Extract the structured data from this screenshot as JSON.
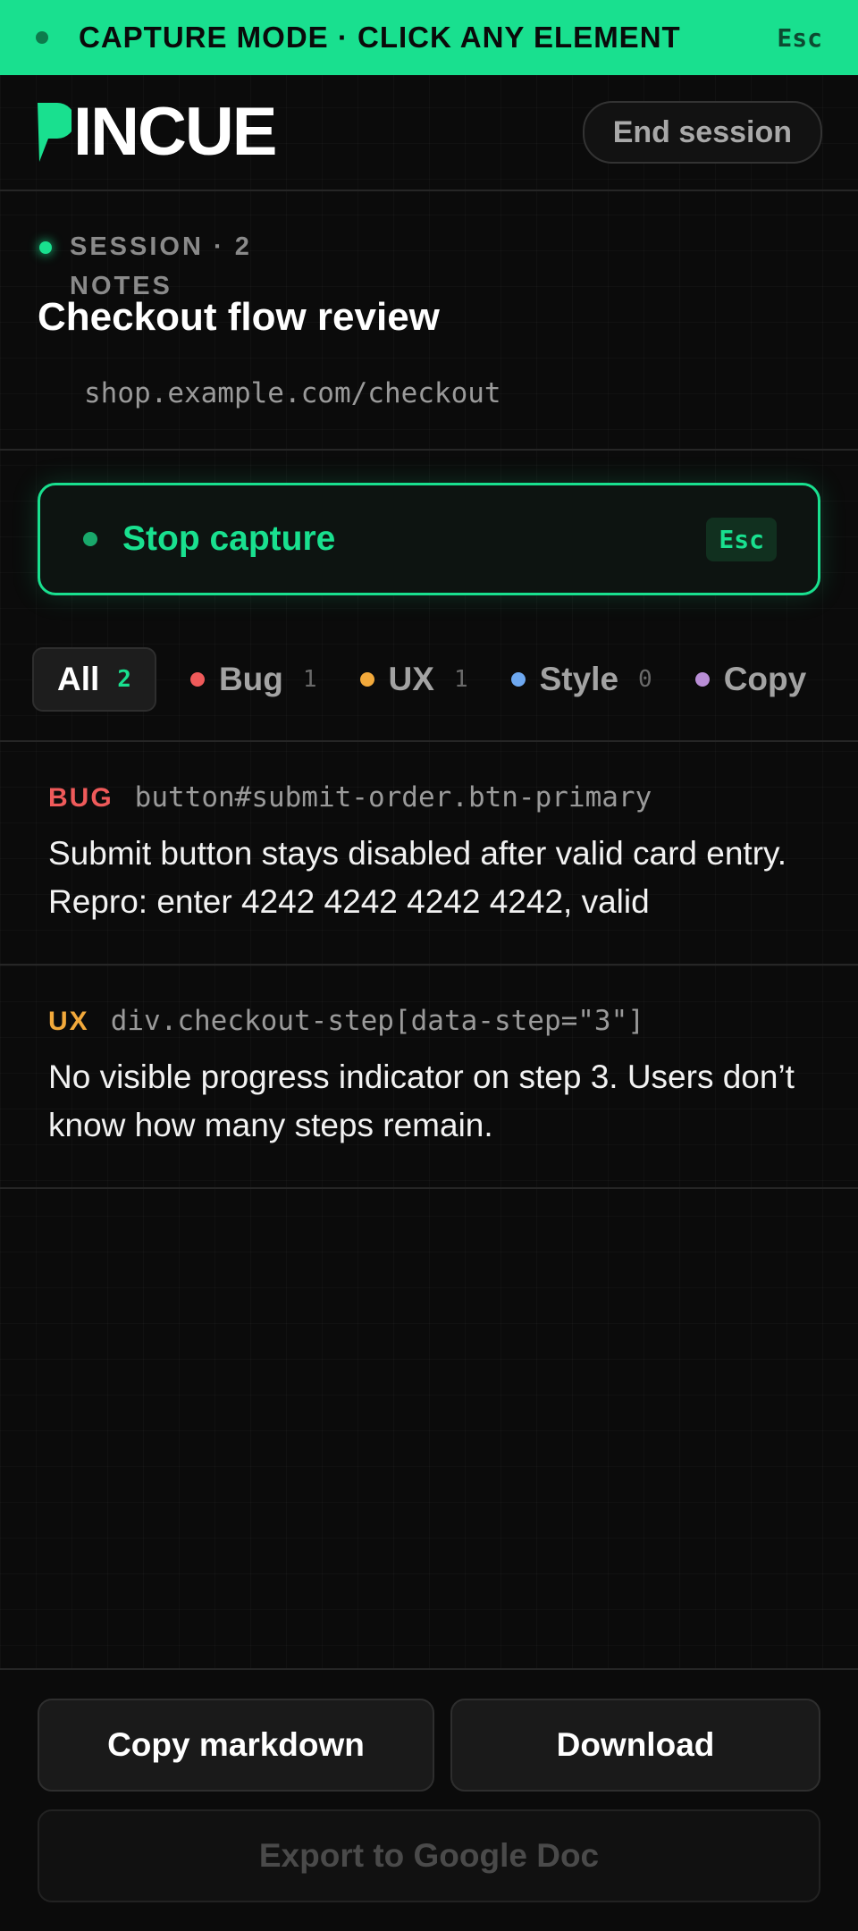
{
  "banner": {
    "text": "CAPTURE MODE · CLICK ANY ELEMENT",
    "esc": "Esc"
  },
  "header": {
    "logo_text": "INCUE",
    "end_session": "End session"
  },
  "session": {
    "meta": "SESSION · 2 NOTES",
    "title": "Checkout flow review",
    "url": "shop.example.com/checkout"
  },
  "capture": {
    "label": "Stop capture",
    "esc": "Esc"
  },
  "filters": [
    {
      "label": "All",
      "count": "2",
      "active": true
    },
    {
      "label": "Bug",
      "count": "1",
      "color": "#ef5a5a"
    },
    {
      "label": "UX",
      "count": "1",
      "color": "#f2a93b"
    },
    {
      "label": "Style",
      "count": "0",
      "color": "#6ea8f0"
    },
    {
      "label": "Copy",
      "count": "",
      "color": "#b98ed6"
    }
  ],
  "notes": [
    {
      "tag": "BUG",
      "tag_color": "#ef5a5a",
      "selector": "button#submit-order.btn-primary",
      "body": "Submit button stays disabled after valid card entry. Repro: enter 4242 4242 4242 4242, valid"
    },
    {
      "tag": "UX",
      "tag_color": "#f2a93b",
      "selector": "div.checkout-step[data-step=\"3\"]",
      "body": "No visible progress indicator on step 3. Users don’t know how many steps remain."
    }
  ],
  "footer": {
    "copy_markdown": "Copy markdown",
    "download": "Download",
    "export": "Export to Google Doc"
  },
  "colors": {
    "accent": "#19e08f",
    "background": "#0b0b0b"
  }
}
